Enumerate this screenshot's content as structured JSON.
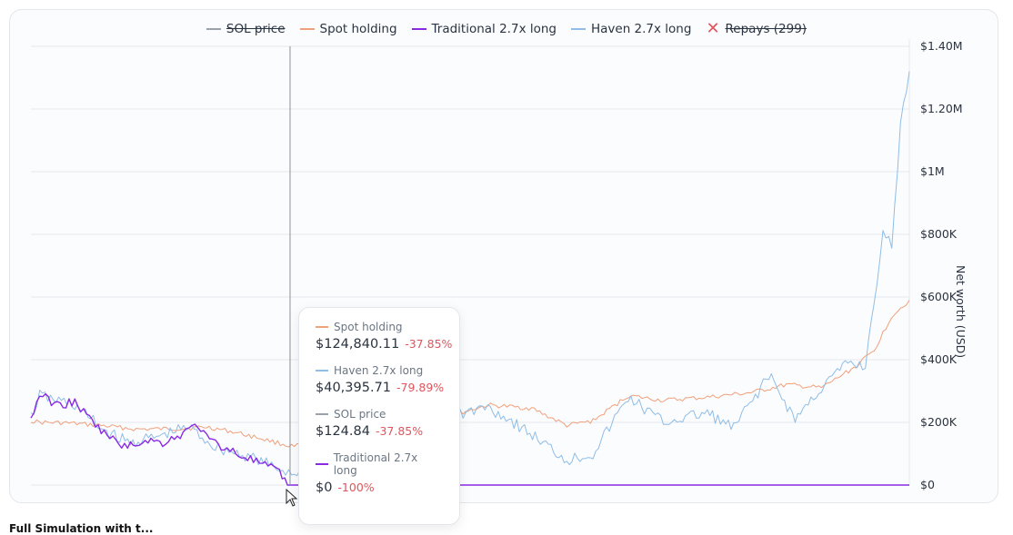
{
  "chart_data": {
    "type": "line",
    "ylabel": "Net worth (USD)",
    "ylim": [
      0,
      1400000
    ],
    "y_ticks": [
      "$0",
      "$200K",
      "$400K",
      "$600K",
      "$800K",
      "$1M",
      "$1.20M",
      "$1.40M"
    ],
    "y_tick_values": [
      0,
      200000,
      400000,
      600000,
      800000,
      1000000,
      1200000,
      1400000
    ],
    "x_range": [
      0,
      1
    ],
    "grid": true,
    "legend_position": "top",
    "legend": [
      {
        "name": "SOL price",
        "color": "#9aa3ad",
        "hidden": true
      },
      {
        "name": "Spot holding",
        "color": "#f0a07a",
        "hidden": false
      },
      {
        "name": "Traditional 2.7x long",
        "color": "#8a2be2",
        "hidden": false
      },
      {
        "name": "Haven 2.7x long",
        "color": "#8fbde6",
        "hidden": false
      },
      {
        "name": "Repays (299)",
        "color": "#e0555c",
        "hidden": true,
        "marker": "x"
      }
    ],
    "series": [
      {
        "name": "Spot holding",
        "color": "#f0a07a",
        "points": [
          [
            0,
            205000
          ],
          [
            0.01,
            200000
          ],
          [
            0.04,
            198000
          ],
          [
            0.08,
            190000
          ],
          [
            0.12,
            178000
          ],
          [
            0.17,
            180000
          ],
          [
            0.2,
            185000
          ],
          [
            0.23,
            170000
          ],
          [
            0.26,
            150000
          ],
          [
            0.29,
            128000
          ],
          [
            0.3,
            122000
          ],
          [
            0.33,
            150000
          ],
          [
            0.38,
            165000
          ],
          [
            0.42,
            185000
          ],
          [
            0.47,
            215000
          ],
          [
            0.52,
            255000
          ],
          [
            0.57,
            245000
          ],
          [
            0.61,
            190000
          ],
          [
            0.64,
            205000
          ],
          [
            0.68,
            285000
          ],
          [
            0.72,
            270000
          ],
          [
            0.77,
            280000
          ],
          [
            0.82,
            295000
          ],
          [
            0.86,
            320000
          ],
          [
            0.9,
            310000
          ],
          [
            0.94,
            380000
          ],
          [
            0.96,
            430000
          ],
          [
            0.98,
            540000
          ],
          [
            1.0,
            590000
          ]
        ]
      },
      {
        "name": "Haven 2.7x long",
        "color": "#8fbde6",
        "points": [
          [
            0,
            215000
          ],
          [
            0.01,
            285000
          ],
          [
            0.05,
            255000
          ],
          [
            0.08,
            180000
          ],
          [
            0.11,
            135000
          ],
          [
            0.14,
            150000
          ],
          [
            0.18,
            185000
          ],
          [
            0.21,
            120000
          ],
          [
            0.25,
            90000
          ],
          [
            0.28,
            52000
          ],
          [
            0.3,
            38000
          ],
          [
            0.33,
            60000
          ],
          [
            0.38,
            90000
          ],
          [
            0.42,
            160000
          ],
          [
            0.47,
            210000
          ],
          [
            0.52,
            250000
          ],
          [
            0.55,
            200000
          ],
          [
            0.58,
            140000
          ],
          [
            0.61,
            80000
          ],
          [
            0.64,
            100000
          ],
          [
            0.68,
            280000
          ],
          [
            0.72,
            200000
          ],
          [
            0.77,
            230000
          ],
          [
            0.8,
            180000
          ],
          [
            0.84,
            350000
          ],
          [
            0.87,
            210000
          ],
          [
            0.9,
            310000
          ],
          [
            0.93,
            390000
          ],
          [
            0.95,
            380000
          ],
          [
            0.97,
            800000
          ],
          [
            0.98,
            760000
          ],
          [
            0.99,
            1150000
          ],
          [
            1.0,
            1320000
          ]
        ]
      },
      {
        "name": "Traditional 2.7x long",
        "color": "#8a2be2",
        "points": [
          [
            0,
            210000
          ],
          [
            0.01,
            290000
          ],
          [
            0.03,
            255000
          ],
          [
            0.05,
            265000
          ],
          [
            0.07,
            200000
          ],
          [
            0.09,
            150000
          ],
          [
            0.11,
            120000
          ],
          [
            0.13,
            145000
          ],
          [
            0.15,
            135000
          ],
          [
            0.17,
            160000
          ],
          [
            0.19,
            195000
          ],
          [
            0.2,
            150000
          ],
          [
            0.22,
            120000
          ],
          [
            0.24,
            95000
          ],
          [
            0.26,
            70000
          ],
          [
            0.28,
            45000
          ],
          [
            0.295,
            0
          ],
          [
            1.0,
            0
          ]
        ]
      }
    ],
    "crosshair_x": 0.295
  },
  "tooltip": {
    "entries": [
      {
        "name": "Spot holding",
        "value": "$124,840.11",
        "change": "-37.85%",
        "color": "#f0a07a"
      },
      {
        "name": "Haven 2.7x long",
        "value": "$40,395.71",
        "change": "-79.89%",
        "color": "#8fbde6"
      },
      {
        "name": "SOL price",
        "value": "$124.84",
        "change": "-37.85%",
        "color": "#9aa3ad"
      },
      {
        "name": "Traditional 2.7x long",
        "value": "$0",
        "change": "-100%",
        "color": "#8a2be2"
      }
    ]
  },
  "bottom_text": "Full Simulation with t..."
}
